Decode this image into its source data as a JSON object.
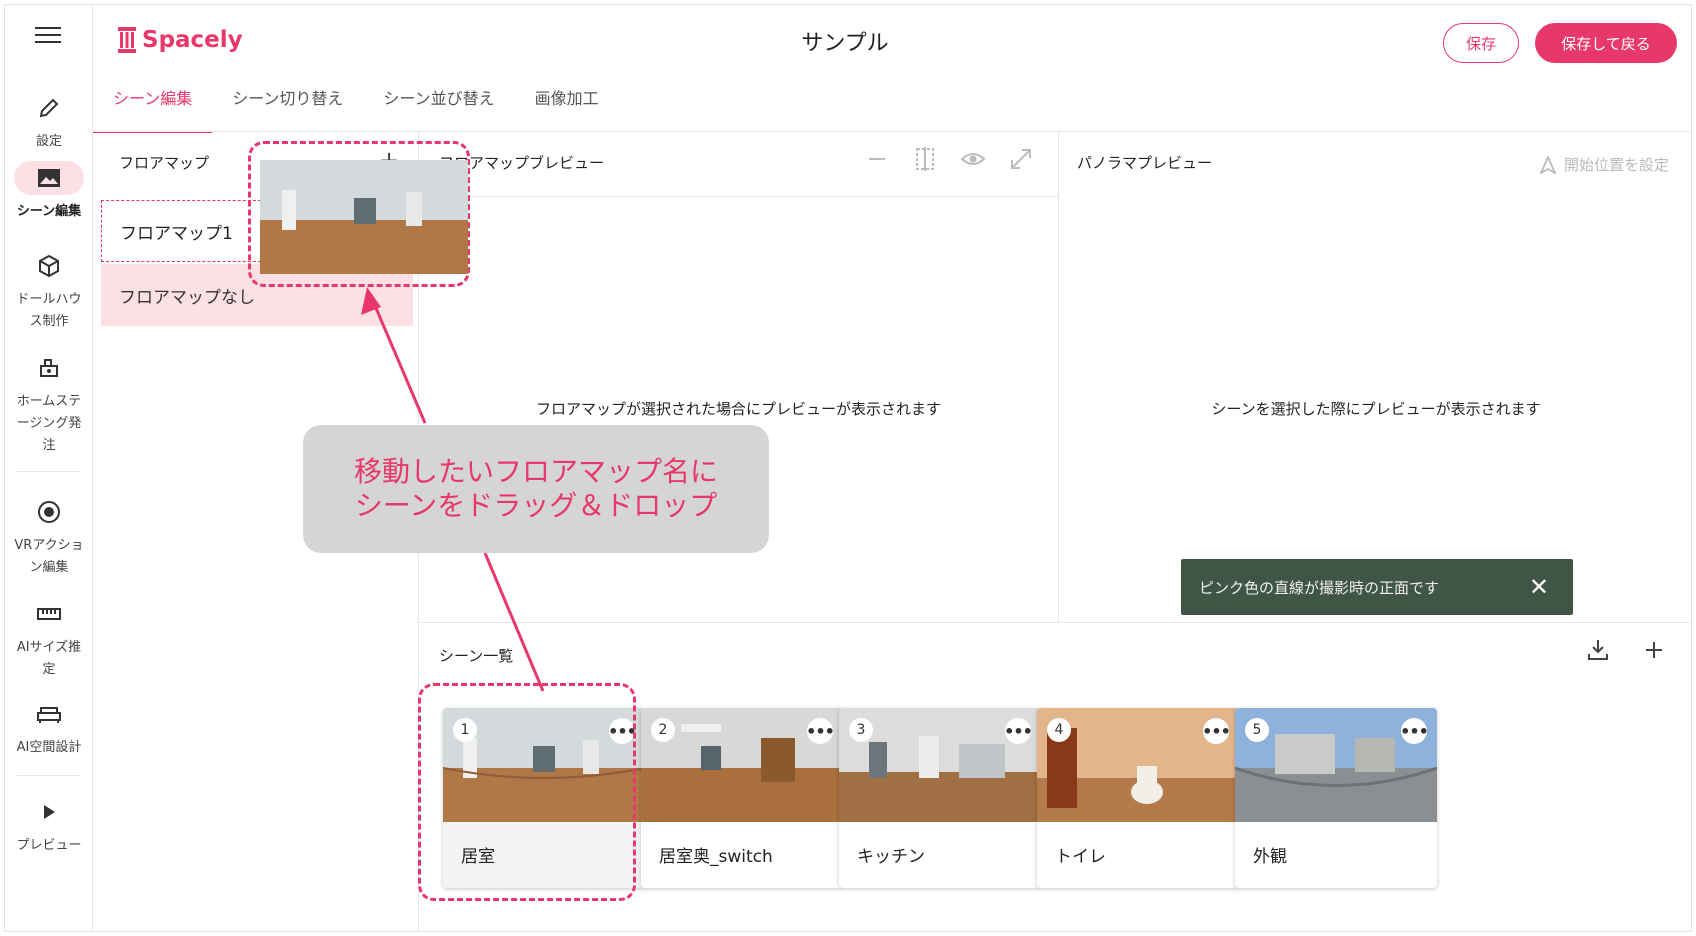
{
  "app": {
    "brand": "Spacely",
    "title": "サンプル"
  },
  "header": {
    "save_label": "保存",
    "save_back_label": "保存して戻る"
  },
  "rail": {
    "items": [
      {
        "label": "設定",
        "icon": "pencil-icon"
      },
      {
        "label": "シーン編集",
        "icon": "image-icon"
      },
      {
        "label": "ドールハウス制作",
        "icon": "cube-icon"
      },
      {
        "label": "ホームステージング発注",
        "icon": "furniture-icon"
      },
      {
        "label": "VRアクション編集",
        "icon": "target-icon"
      },
      {
        "label": "AIサイズ推定",
        "icon": "ruler-icon"
      },
      {
        "label": "AI空間設計",
        "icon": "sofa-icon"
      },
      {
        "label": "プレビュー",
        "icon": "play-icon"
      }
    ]
  },
  "tabs": [
    {
      "label": "シーン編集",
      "active": true
    },
    {
      "label": "シーン切り替え"
    },
    {
      "label": "シーン並び替え"
    },
    {
      "label": "画像加工"
    }
  ],
  "floormap": {
    "heading": "フロアマップ",
    "items": [
      "フロアマップ1",
      "フロアマップなし"
    ]
  },
  "floormap_preview": {
    "heading": "フロアマップブレビュー",
    "message": "フロアマップが選択された場合にプレビューが表示されます"
  },
  "pano_preview": {
    "heading": "パノラマプレビュー",
    "start_label": "開始位置を設定",
    "message": "シーンを選択した際にプレビューが表示されます",
    "toast": "ピンク色の直線が撮影時の正面です"
  },
  "scene_list": {
    "heading": "シーン一覧",
    "scenes": [
      {
        "num": "1",
        "name": "居室"
      },
      {
        "num": "2",
        "name": "居室奥_switch"
      },
      {
        "num": "3",
        "name": "キッチン"
      },
      {
        "num": "4",
        "name": "トイレ"
      },
      {
        "num": "5",
        "name": "外観"
      }
    ]
  },
  "callout": {
    "line1": "移動したいフロアマップ名に",
    "line2": "シーンをドラッグ＆ドロップ"
  },
  "colors": {
    "accent": "#e8386b",
    "toast_bg": "#3f5646",
    "selected_bg": "#fde0e6"
  }
}
